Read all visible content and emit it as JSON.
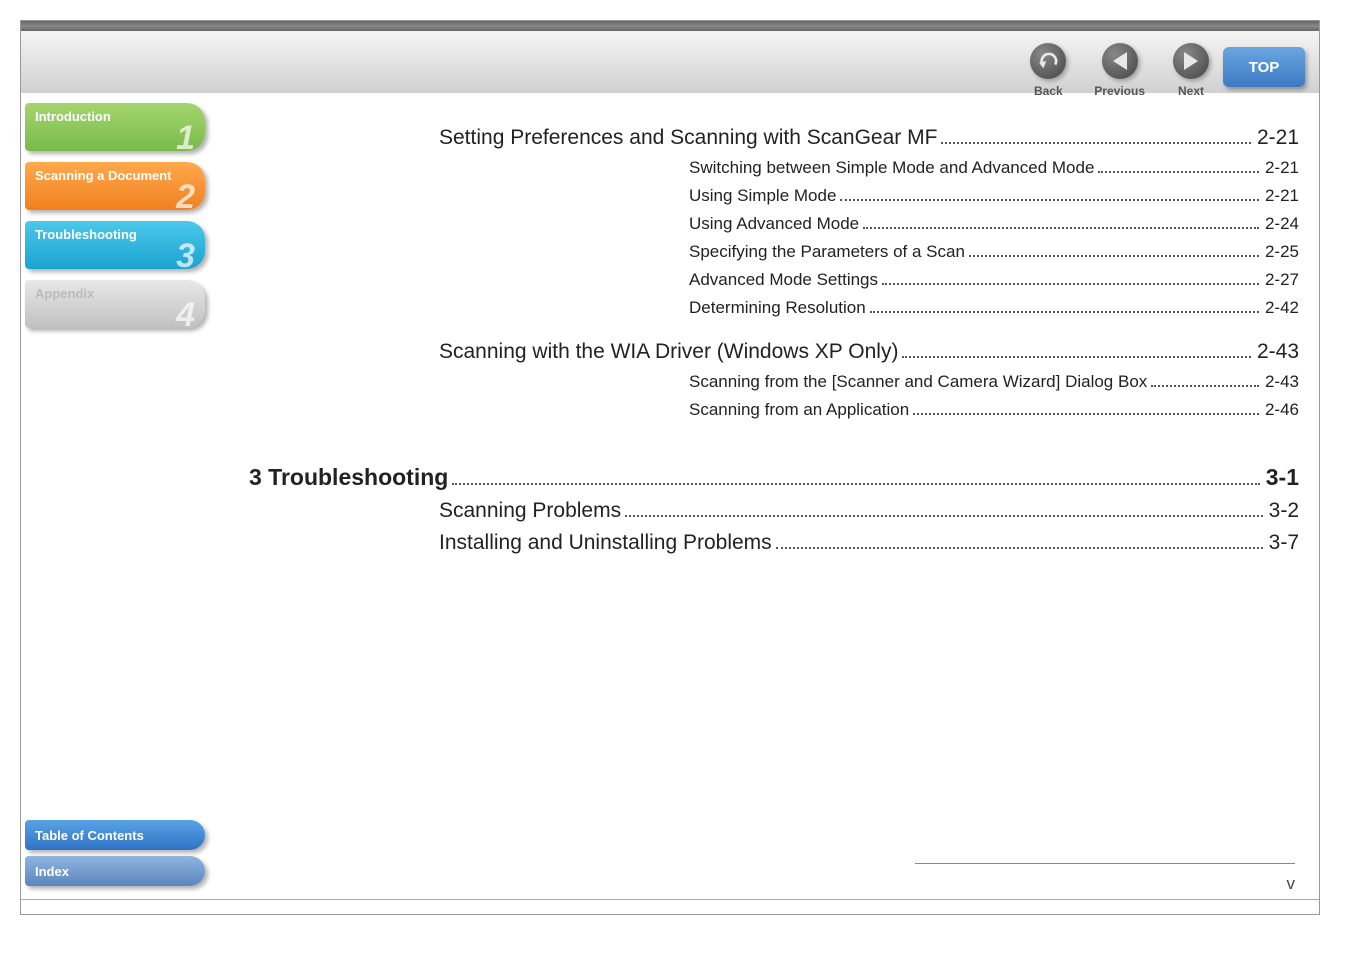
{
  "header": {
    "back_label": "Back",
    "previous_label": "Previous",
    "next_label": "Next",
    "top_label": "TOP"
  },
  "sidebar": {
    "tabs": [
      {
        "label": "Introduction",
        "num": "1"
      },
      {
        "label": "Scanning a Document",
        "num": "2"
      },
      {
        "label": "Troubleshooting",
        "num": "3"
      },
      {
        "label": "Appendix",
        "num": "4"
      }
    ],
    "toc_label": "Table of Contents",
    "index_label": "Index"
  },
  "toc": {
    "sections": [
      {
        "level": "h2",
        "title": "Setting Preferences and Scanning with ScanGear MF",
        "page": "2-21",
        "children": [
          {
            "level": "h3",
            "title": "Switching between Simple Mode and Advanced Mode",
            "page": "2-21"
          },
          {
            "level": "h3",
            "title": "Using Simple Mode",
            "page": "2-21"
          },
          {
            "level": "h3",
            "title": "Using Advanced Mode",
            "page": "2-24"
          },
          {
            "level": "h3",
            "title": "Specifying the Parameters of a Scan",
            "page": "2-25"
          },
          {
            "level": "h3",
            "title": "Advanced Mode Settings",
            "page": "2-27"
          },
          {
            "level": "h3",
            "title": "Determining Resolution",
            "page": "2-42"
          }
        ]
      },
      {
        "level": "h2",
        "title": "Scanning with the WIA Driver (Windows XP Only)",
        "page": "2-43",
        "children": [
          {
            "level": "h3",
            "title": "Scanning from the [Scanner and Camera Wizard] Dialog Box",
            "page": "2-43"
          },
          {
            "level": "h3",
            "title": "Scanning from an Application",
            "page": "2-46"
          }
        ]
      },
      {
        "level": "h1",
        "title": "3 Troubleshooting",
        "page": "3-1",
        "children": [
          {
            "level": "h2",
            "title": "Scanning Problems",
            "page": "3-2"
          },
          {
            "level": "h2",
            "title": "Installing and Uninstalling Problems",
            "page": "3-7"
          }
        ]
      }
    ]
  },
  "page_number": "v"
}
